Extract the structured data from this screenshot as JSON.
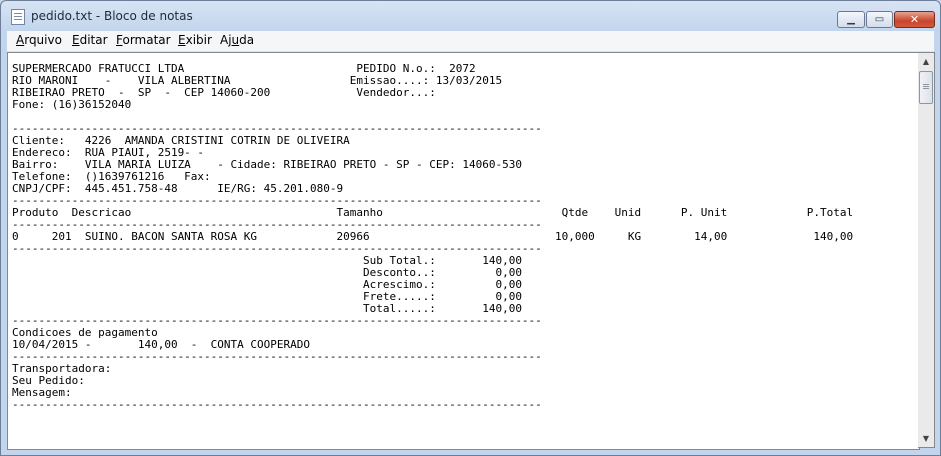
{
  "window": {
    "title": "pedido.txt - Bloco de notas"
  },
  "menu": [
    {
      "accel": "A",
      "rest": "rquivo"
    },
    {
      "accel": "E",
      "rest": "ditar"
    },
    {
      "accel": "F",
      "rest": "ormatar"
    },
    {
      "accel": "E",
      "rest": "xibir"
    },
    {
      "pre": "Aj",
      "accel": "u",
      "rest": "da"
    }
  ],
  "document": {
    "content": "SUPERMERCADO FRATUCCI LTDA                          PEDIDO N.o.:  2072\nRIO MARONI    -    VILA ALBERTINA                  Emissao....: 13/03/2015\nRIBEIRAO PRETO  -  SP  -  CEP 14060-200             Vendedor...:\nFone: (16)36152040\n\n--------------------------------------------------------------------------------\nCliente:   4226  AMANDA CRISTINI COTRIN DE OLIVEIRA\nEndereco:  RUA PIAUI, 2519- -\nBairro:    VILA MARIA LUIZA    - Cidade: RIBEIRAO PRETO - SP - CEP: 14060-530\nTelefone:  ()1639761216   Fax:\nCNPJ/CPF:  445.451.758-48      IE/RG: 45.201.080-9\n--------------------------------------------------------------------------------\nProduto  Descricao                               Tamanho                           Qtde    Unid      P. Unit            P.Total\n--------------------------------------------------------------------------------\n0     201  SUINO. BACON SANTA ROSA KG            20966                            10,000     KG        14,00             140,00\n--------------------------------------------------------------------------------\n                                                     Sub Total.:       140,00\n                                                     Desconto..:         0,00\n                                                     Acrescimo.:         0,00\n                                                     Frete.....:         0,00\n                                                     Total.....:       140,00\n--------------------------------------------------------------------------------\nCondicoes de pagamento\n10/04/2015 -       140,00  -  CONTA COOPERADO\n--------------------------------------------------------------------------------\nTransportadora:\nSeu Pedido:\nMensagem:\n--------------------------------------------------------------------------------"
  }
}
